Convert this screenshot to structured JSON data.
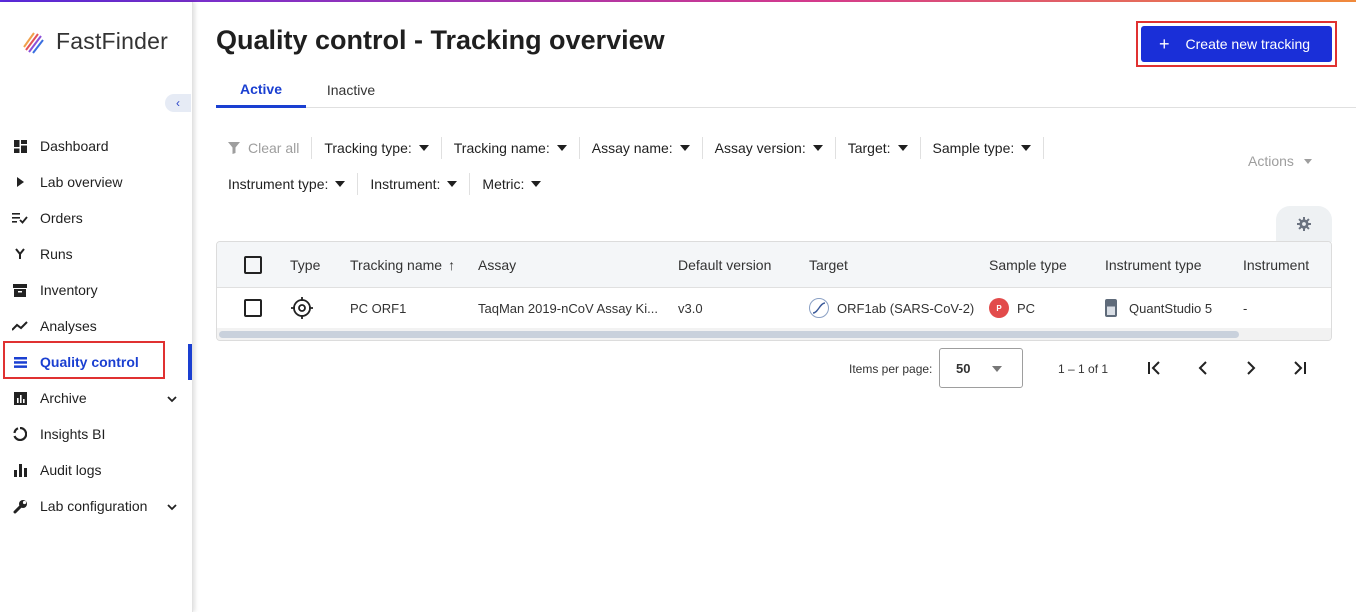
{
  "app": {
    "name": "FastFinder"
  },
  "sidebar": {
    "collapse_glyph": "‹",
    "items": [
      {
        "label": "Dashboard",
        "icon": "dashboard-icon"
      },
      {
        "label": "Lab overview",
        "icon": "play-arrow-icon"
      },
      {
        "label": "Orders",
        "icon": "orders-list-icon"
      },
      {
        "label": "Runs",
        "icon": "fork-icon"
      },
      {
        "label": "Inventory",
        "icon": "inventory-box-icon"
      },
      {
        "label": "Analyses",
        "icon": "trend-line-icon"
      },
      {
        "label": "Quality control",
        "icon": "qc-lines-icon",
        "active": true
      },
      {
        "label": "Archive",
        "icon": "archive-chart-icon",
        "expandable": true
      },
      {
        "label": "Insights BI",
        "icon": "insights-ring-icon"
      },
      {
        "label": "Audit logs",
        "icon": "bar-chart-icon"
      },
      {
        "label": "Lab configuration",
        "icon": "wrench-icon",
        "expandable": true
      }
    ]
  },
  "header": {
    "title": "Quality control - Tracking overview",
    "create_button": {
      "plus": "+",
      "label": "Create new tracking"
    }
  },
  "tabs": [
    {
      "label": "Active",
      "active": true
    },
    {
      "label": "Inactive",
      "active": false
    }
  ],
  "filters": {
    "clear_all": "Clear all",
    "row1": [
      "Tracking type:",
      "Tracking name:",
      "Assay name:",
      "Assay version:",
      "Target:",
      "Sample type:"
    ],
    "row2": [
      "Instrument type:",
      "Instrument:",
      "Metric:"
    ],
    "actions": "Actions"
  },
  "table": {
    "columns": {
      "type": "Type",
      "tracking_name": "Tracking name",
      "sort_glyph": "↑",
      "assay": "Assay",
      "default_version": "Default version",
      "target": "Target",
      "sample_type": "Sample type",
      "instrument_type": "Instrument type",
      "instrument": "Instrument"
    },
    "rows": [
      {
        "type_icon": "target-crosshair-icon",
        "tracking_name": "PC ORF1",
        "assay": "TaqMan 2019-nCoV Assay Ki...",
        "default_version": "v3.0",
        "target": "ORF1ab (SARS-CoV-2)",
        "sample_badge": "P",
        "sample_type": "PC",
        "instrument_type": "QuantStudio 5",
        "instrument": "-"
      }
    ]
  },
  "paginator": {
    "items_per_page_label": "Items per page:",
    "items_per_page": "50",
    "range": "1 – 1 of 1"
  },
  "colors": {
    "primary": "#1a2fd8",
    "active_nav": "#1a3fd1",
    "highlight": "#e03131",
    "badge_red": "#e24b4b"
  }
}
